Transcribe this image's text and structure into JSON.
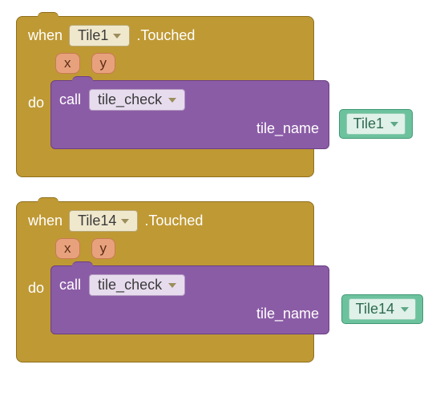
{
  "blocks": [
    {
      "when": "when",
      "component": "Tile1",
      "event": ".Touched",
      "params": [
        "x",
        "y"
      ],
      "do": "do",
      "call": "call",
      "procedure": "tile_check",
      "arg_label": "tile_name",
      "arg_value": "Tile1"
    },
    {
      "when": "when",
      "component": "Tile14",
      "event": ".Touched",
      "params": [
        "x",
        "y"
      ],
      "do": "do",
      "call": "call",
      "procedure": "tile_check",
      "arg_label": "tile_name",
      "arg_value": "Tile14"
    }
  ]
}
